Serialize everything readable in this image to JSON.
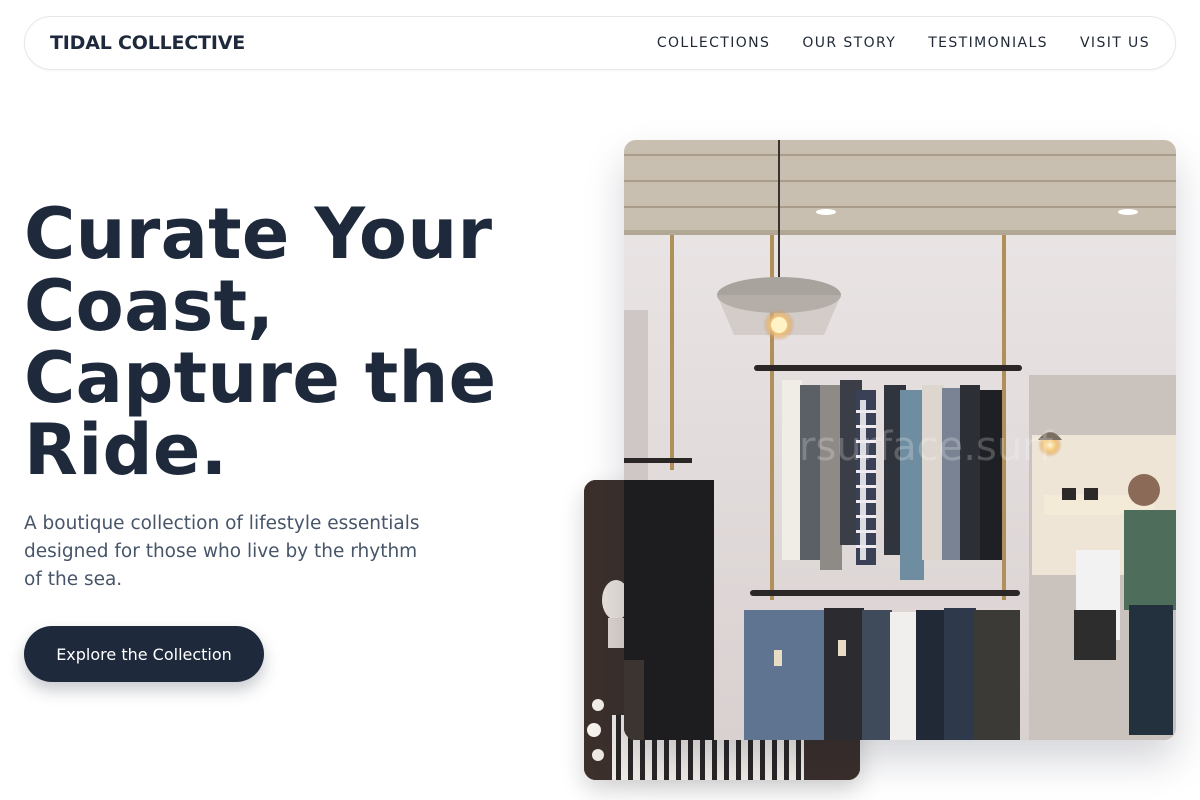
{
  "nav": {
    "brand": "TIDAL COLLECTIVE",
    "links": [
      "COLLECTIONS",
      "OUR STORY",
      "TESTIMONIALS",
      "VISIT US"
    ]
  },
  "hero": {
    "headline": [
      "Curate Your",
      "Coast,",
      "Capture the",
      "Ride."
    ],
    "subtext": [
      "A boutique collection of lifestyle essentials",
      "designed for those who live by the rhythm",
      "of the sea."
    ],
    "cta": "Explore the Collection"
  },
  "images": {
    "main": "clothing-store-interior",
    "secondary": "boutique-mannequin"
  },
  "colors": {
    "primary": "#1e293b",
    "text_muted": "#475569",
    "background": "#ffffff"
  }
}
